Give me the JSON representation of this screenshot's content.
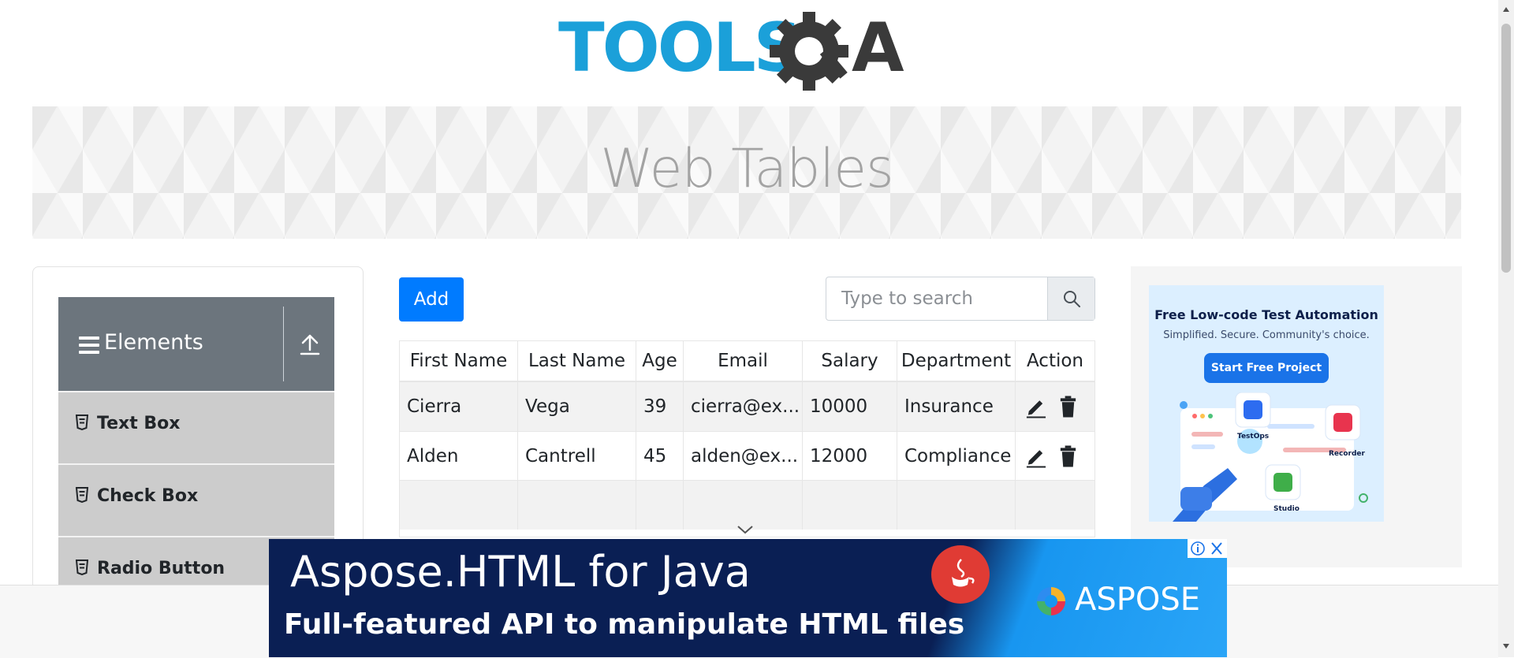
{
  "header": {
    "logo_text": "TOOLSQA",
    "logo_icon": "gear-magnifier-logo"
  },
  "banner": {
    "title": "Web Tables"
  },
  "sidebar": {
    "group": {
      "label": "Elements",
      "menu_icon": "hamburger-icon",
      "toggle_icon": "upload-arrow-icon"
    },
    "items": [
      {
        "label": "Text Box",
        "icon": "document-icon"
      },
      {
        "label": "Check Box",
        "icon": "document-icon"
      },
      {
        "label": "Radio Button",
        "icon": "document-icon"
      }
    ]
  },
  "controls": {
    "add_label": "Add",
    "search": {
      "placeholder": "Type to search",
      "value": "",
      "icon": "search-icon"
    }
  },
  "table": {
    "columns": [
      "First Name",
      "Last Name",
      "Age",
      "Email",
      "Salary",
      "Department",
      "Action"
    ],
    "rows": [
      {
        "first_name": "Cierra",
        "last_name": "Vega",
        "age": "39",
        "email": "cierra@ex...",
        "salary": "10000",
        "department": "Insurance"
      },
      {
        "first_name": "Alden",
        "last_name": "Cantrell",
        "age": "45",
        "email": "alden@ex...",
        "salary": "12000",
        "department": "Compliance"
      }
    ],
    "action_icons": [
      "edit-pencil-icon",
      "delete-trash-icon"
    ],
    "more_icon": "chevron-down-icon"
  },
  "right_ad": {
    "headline": "Free Low-code Test Automation",
    "subline": "Simplified. Secure. Community's choice.",
    "cta": "Start Free Project",
    "labels": [
      "TestOps",
      "Recorder",
      "Studio"
    ]
  },
  "bottom_ad": {
    "line1": "Aspose.HTML for Java",
    "line2": "Full-featured API to manipulate HTML files",
    "brand": "ASPOSE",
    "controls": [
      "ad-info-icon",
      "close-icon"
    ]
  },
  "colors": {
    "primary": "#007bff",
    "group_header": "#6c757d",
    "menu_item": "#cccccc",
    "banner_text": "#a3a3a3",
    "logo_blue": "#1ba0d9",
    "logo_dark": "#3a3a3a",
    "ad_navy": "#0a1f54"
  }
}
